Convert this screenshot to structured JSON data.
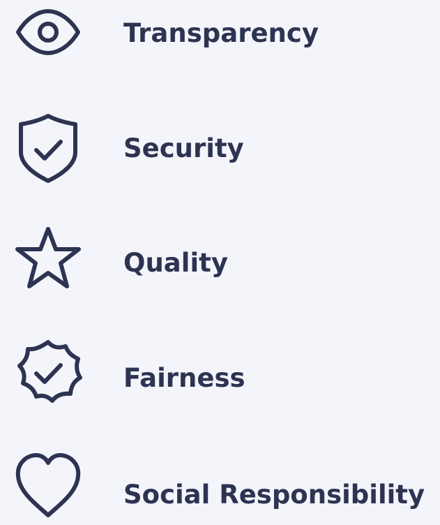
{
  "values": [
    {
      "label": "Transparency",
      "icon": "eye-icon"
    },
    {
      "label": "Security",
      "icon": "shield-check-icon"
    },
    {
      "label": "Quality",
      "icon": "star-icon"
    },
    {
      "label": "Fairness",
      "icon": "badge-check-icon"
    },
    {
      "label": "Social Responsibility",
      "icon": "heart-icon"
    }
  ],
  "colors": {
    "background": "#f4f5fa",
    "foreground": "#2d3452"
  }
}
